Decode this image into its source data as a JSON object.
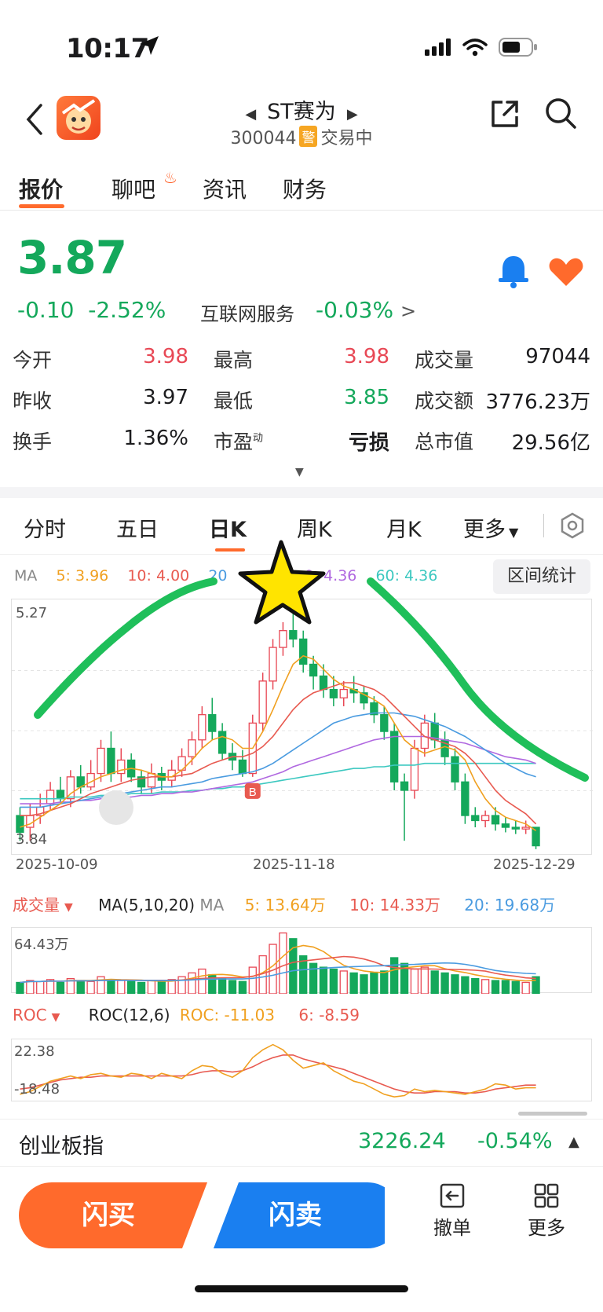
{
  "status_bar": {
    "time": "10:17"
  },
  "header": {
    "stock_name": "ST赛为",
    "stock_code": "300044",
    "warn_badge": "警",
    "trade_status": "交易中"
  },
  "main_tabs": [
    {
      "label": "报价",
      "active": true
    },
    {
      "label": "聊吧",
      "active": false
    },
    {
      "label": "资讯",
      "active": false
    },
    {
      "label": "财务",
      "active": false
    }
  ],
  "quote": {
    "price": "3.87",
    "change": "-0.10",
    "change_pct": "-2.52%",
    "industry": "互联网服务",
    "industry_change": "-0.03%",
    "industry_caret": ">"
  },
  "stats": [
    {
      "label": "今开",
      "value": "3.98",
      "color": "red"
    },
    {
      "label": "最高",
      "value": "3.98",
      "color": "red"
    },
    {
      "label": "成交量",
      "value": "97044",
      "color": "dark"
    },
    {
      "label": "昨收",
      "value": "3.97",
      "color": "dark"
    },
    {
      "label": "最低",
      "value": "3.85",
      "color": "green"
    },
    {
      "label": "成交额",
      "value": "3776.23万",
      "color": "dark"
    },
    {
      "label": "换手",
      "value": "1.36%",
      "color": "dark"
    },
    {
      "label": "市盈",
      "sup": "动",
      "value": "亏损",
      "color": "dark"
    },
    {
      "label": "总市值",
      "value": "29.56亿",
      "color": "dark"
    }
  ],
  "kline_tabs": [
    {
      "label": "分时",
      "active": false
    },
    {
      "label": "五日",
      "active": false
    },
    {
      "label": "日K",
      "active": true
    },
    {
      "label": "周K",
      "active": false
    },
    {
      "label": "月K",
      "active": false
    },
    {
      "label": "更多",
      "active": false
    }
  ],
  "ma_legend": {
    "title": "MA",
    "ma5": "5: 3.96",
    "ma10": "10: 4.00",
    "ma20": "20",
    "ma30": "0: 4.36",
    "ma60": "60: 4.36",
    "range_button": "区间统计"
  },
  "colors": {
    "up": "#e84855",
    "down": "#14a85b",
    "ma5": "#f0a020",
    "ma10": "#e85a50",
    "ma20": "#4a9be0",
    "ma30": "#b068e0",
    "ma60": "#3cc8c0",
    "accent": "#ff6a2c",
    "sell": "#1a7ff0"
  },
  "chart_data": [
    {
      "type": "candlestick",
      "y_max_label": "5.27",
      "y_min_label": "3.84",
      "ylim": [
        3.84,
        5.27
      ],
      "x_labels": [
        "2025-10-09",
        "2025-11-18",
        "2025-12-29"
      ],
      "buy_marker": "B",
      "candles": [
        [
          4.05,
          3.95,
          4.1,
          3.9
        ],
        [
          3.98,
          4.05,
          4.12,
          3.9
        ],
        [
          4.05,
          4.1,
          4.18,
          4.0
        ],
        [
          4.12,
          4.2,
          4.25,
          4.08
        ],
        [
          4.2,
          4.15,
          4.28,
          4.12
        ],
        [
          4.15,
          4.28,
          4.32,
          4.1
        ],
        [
          4.28,
          4.22,
          4.35,
          4.18
        ],
        [
          4.22,
          4.3,
          4.38,
          4.2
        ],
        [
          4.3,
          4.45,
          4.5,
          4.25
        ],
        [
          4.45,
          4.3,
          4.55,
          4.25
        ],
        [
          4.3,
          4.38,
          4.45,
          4.25
        ],
        [
          4.38,
          4.28,
          4.42,
          4.25
        ],
        [
          4.28,
          4.22,
          4.32,
          4.18
        ],
        [
          4.22,
          4.3,
          4.36,
          4.18
        ],
        [
          4.3,
          4.26,
          4.34,
          4.2
        ],
        [
          4.26,
          4.32,
          4.38,
          4.22
        ],
        [
          4.32,
          4.4,
          4.45,
          4.28
        ],
        [
          4.4,
          4.5,
          4.55,
          4.35
        ],
        [
          4.5,
          4.65,
          4.7,
          4.45
        ],
        [
          4.65,
          4.55,
          4.75,
          4.5
        ],
        [
          4.55,
          4.42,
          4.6,
          4.38
        ],
        [
          4.42,
          4.38,
          4.48,
          4.32
        ],
        [
          4.38,
          4.3,
          4.44,
          4.28
        ],
        [
          4.3,
          4.6,
          4.65,
          4.28
        ],
        [
          4.6,
          4.85,
          4.9,
          4.55
        ],
        [
          4.85,
          5.05,
          5.1,
          4.8
        ],
        [
          5.05,
          5.15,
          5.2,
          5.0
        ],
        [
          5.15,
          5.1,
          5.27,
          5.05
        ],
        [
          5.1,
          4.95,
          5.15,
          4.9
        ],
        [
          4.95,
          4.88,
          5.0,
          4.8
        ],
        [
          4.88,
          4.8,
          4.95,
          4.75
        ],
        [
          4.8,
          4.75,
          4.88,
          4.7
        ],
        [
          4.75,
          4.8,
          4.85,
          4.7
        ],
        [
          4.8,
          4.78,
          4.88,
          4.72
        ],
        [
          4.78,
          4.72,
          4.82,
          4.68
        ],
        [
          4.72,
          4.65,
          4.76,
          4.6
        ],
        [
          4.65,
          4.55,
          4.7,
          4.5
        ],
        [
          4.55,
          4.25,
          4.6,
          4.2
        ],
        [
          4.25,
          4.2,
          4.3,
          3.9
        ],
        [
          4.2,
          4.45,
          4.5,
          4.15
        ],
        [
          4.45,
          4.6,
          4.65,
          4.4
        ],
        [
          4.6,
          4.5,
          4.66,
          4.45
        ],
        [
          4.5,
          4.4,
          4.55,
          4.35
        ],
        [
          4.4,
          4.25,
          4.45,
          4.2
        ],
        [
          4.25,
          4.05,
          4.3,
          4.0
        ],
        [
          4.05,
          4.02,
          4.1,
          3.98
        ],
        [
          4.02,
          4.05,
          4.08,
          3.98
        ],
        [
          4.05,
          4.0,
          4.1,
          3.96
        ],
        [
          4.0,
          3.98,
          4.04,
          3.95
        ],
        [
          3.98,
          3.97,
          4.02,
          3.94
        ],
        [
          3.97,
          3.98,
          4.02,
          3.94
        ],
        [
          3.98,
          3.87,
          3.98,
          3.85
        ]
      ],
      "ma5": [
        3.98,
        4.0,
        4.04,
        4.08,
        4.12,
        4.18,
        4.22,
        4.25,
        4.28,
        4.3,
        4.32,
        4.33,
        4.32,
        4.3,
        4.28,
        4.28,
        4.32,
        4.38,
        4.45,
        4.5,
        4.52,
        4.5,
        4.45,
        4.45,
        4.55,
        4.68,
        4.82,
        4.95,
        5.0,
        4.98,
        4.92,
        4.86,
        4.82,
        4.8,
        4.77,
        4.74,
        4.7,
        4.6,
        4.5,
        4.45,
        4.42,
        4.44,
        4.46,
        4.44,
        4.38,
        4.25,
        4.15,
        4.08,
        4.04,
        4.02,
        4.0,
        3.96
      ],
      "ma10": [
        4.05,
        4.05,
        4.06,
        4.08,
        4.1,
        4.12,
        4.15,
        4.18,
        4.2,
        4.22,
        4.24,
        4.26,
        4.27,
        4.28,
        4.28,
        4.28,
        4.29,
        4.3,
        4.33,
        4.36,
        4.38,
        4.4,
        4.4,
        4.42,
        4.46,
        4.52,
        4.6,
        4.68,
        4.74,
        4.78,
        4.8,
        4.82,
        4.84,
        4.84,
        4.82,
        4.8,
        4.76,
        4.7,
        4.64,
        4.58,
        4.52,
        4.5,
        4.48,
        4.46,
        4.42,
        4.36,
        4.28,
        4.2,
        4.14,
        4.1,
        4.06,
        4.0
      ],
      "ma20": [
        4.1,
        4.1,
        4.1,
        4.11,
        4.12,
        4.13,
        4.14,
        4.15,
        4.16,
        4.17,
        4.18,
        4.19,
        4.2,
        4.21,
        4.22,
        4.22,
        4.23,
        4.24,
        4.25,
        4.27,
        4.28,
        4.29,
        4.3,
        4.31,
        4.33,
        4.36,
        4.4,
        4.44,
        4.48,
        4.52,
        4.56,
        4.6,
        4.62,
        4.64,
        4.65,
        4.66,
        4.66,
        4.66,
        4.65,
        4.64,
        4.62,
        4.6,
        4.58,
        4.55,
        4.52,
        4.48,
        4.44,
        4.4,
        4.36,
        4.33,
        4.3,
        4.28
      ],
      "ma30": [
        4.12,
        4.12,
        4.12,
        4.12,
        4.13,
        4.13,
        4.14,
        4.14,
        4.15,
        4.15,
        4.16,
        4.16,
        4.17,
        4.17,
        4.18,
        4.18,
        4.19,
        4.19,
        4.2,
        4.21,
        4.22,
        4.23,
        4.24,
        4.25,
        4.27,
        4.29,
        4.31,
        4.34,
        4.36,
        4.38,
        4.4,
        4.42,
        4.44,
        4.46,
        4.48,
        4.5,
        4.51,
        4.52,
        4.52,
        4.52,
        4.52,
        4.51,
        4.5,
        4.49,
        4.48,
        4.46,
        4.44,
        4.42,
        4.4,
        4.39,
        4.38,
        4.36
      ],
      "ma60": [
        4.15,
        4.15,
        4.15,
        4.15,
        4.15,
        4.16,
        4.16,
        4.16,
        4.17,
        4.17,
        4.17,
        4.18,
        4.18,
        4.18,
        4.19,
        4.19,
        4.19,
        4.2,
        4.2,
        4.21,
        4.21,
        4.22,
        4.22,
        4.23,
        4.24,
        4.25,
        4.26,
        4.27,
        4.28,
        4.29,
        4.3,
        4.31,
        4.32,
        4.33,
        4.33,
        4.34,
        4.34,
        4.35,
        4.35,
        4.35,
        4.36,
        4.36,
        4.36,
        4.36,
        4.36,
        4.36,
        4.36,
        4.36,
        4.36,
        4.36,
        4.36,
        4.36
      ]
    },
    {
      "type": "bar",
      "title": "成交量",
      "indicator": "MA(5,10,20)",
      "indicator_suffix": "MA",
      "ma5_label": "5: 13.64万",
      "ma10_label": "10: 14.33万",
      "ma20_label": "20: 19.68万",
      "y_max_label": "64.43万",
      "values": [
        12,
        14,
        13,
        15,
        12,
        16,
        14,
        13,
        18,
        15,
        14,
        13,
        12,
        14,
        13,
        15,
        18,
        22,
        26,
        20,
        16,
        14,
        13,
        28,
        40,
        52,
        64,
        58,
        40,
        32,
        28,
        26,
        24,
        22,
        20,
        22,
        24,
        38,
        32,
        26,
        28,
        24,
        22,
        20,
        18,
        16,
        15,
        14,
        14,
        13,
        12,
        18
      ]
    },
    {
      "type": "line",
      "title": "ROC",
      "indicator": "ROC(12,6)",
      "roc_label": "ROC: -11.03",
      "roc6_label": "6: -8.59",
      "y_max_label": "22.38",
      "y_min_label": "-18.48",
      "roc": [
        -16,
        -14,
        -10,
        -6,
        -4,
        -2,
        -4,
        -1,
        0,
        -2,
        -3,
        0,
        -1,
        -4,
        0,
        -2,
        -4,
        2,
        6,
        5,
        0,
        -3,
        2,
        12,
        18,
        22,
        18,
        10,
        4,
        6,
        8,
        2,
        -2,
        -6,
        -8,
        -12,
        -16,
        -18,
        -17,
        -12,
        -14,
        -13,
        -14,
        -15,
        -16,
        -14,
        -12,
        -8,
        -9,
        -12,
        -11,
        -11
      ],
      "roc6": [
        -12,
        -11,
        -9,
        -7,
        -5,
        -4,
        -3,
        -3,
        -2,
        -2,
        -2,
        -2,
        -2,
        -2,
        -2,
        -2,
        -2,
        -1,
        1,
        2,
        2,
        1,
        2,
        5,
        9,
        12,
        14,
        14,
        11,
        9,
        7,
        5,
        3,
        0,
        -3,
        -6,
        -9,
        -12,
        -14,
        -15,
        -15,
        -14,
        -14,
        -14,
        -15,
        -15,
        -14,
        -12,
        -11,
        -10,
        -9,
        -9
      ]
    }
  ],
  "index_bar": {
    "name": "创业板指",
    "value": "3226.24",
    "change_pct": "-0.54%",
    "caret": "▲"
  },
  "bottom": {
    "buy_label": "闪买",
    "sell_label": "闪卖",
    "cancel_label": "撤单",
    "more_label": "更多"
  }
}
